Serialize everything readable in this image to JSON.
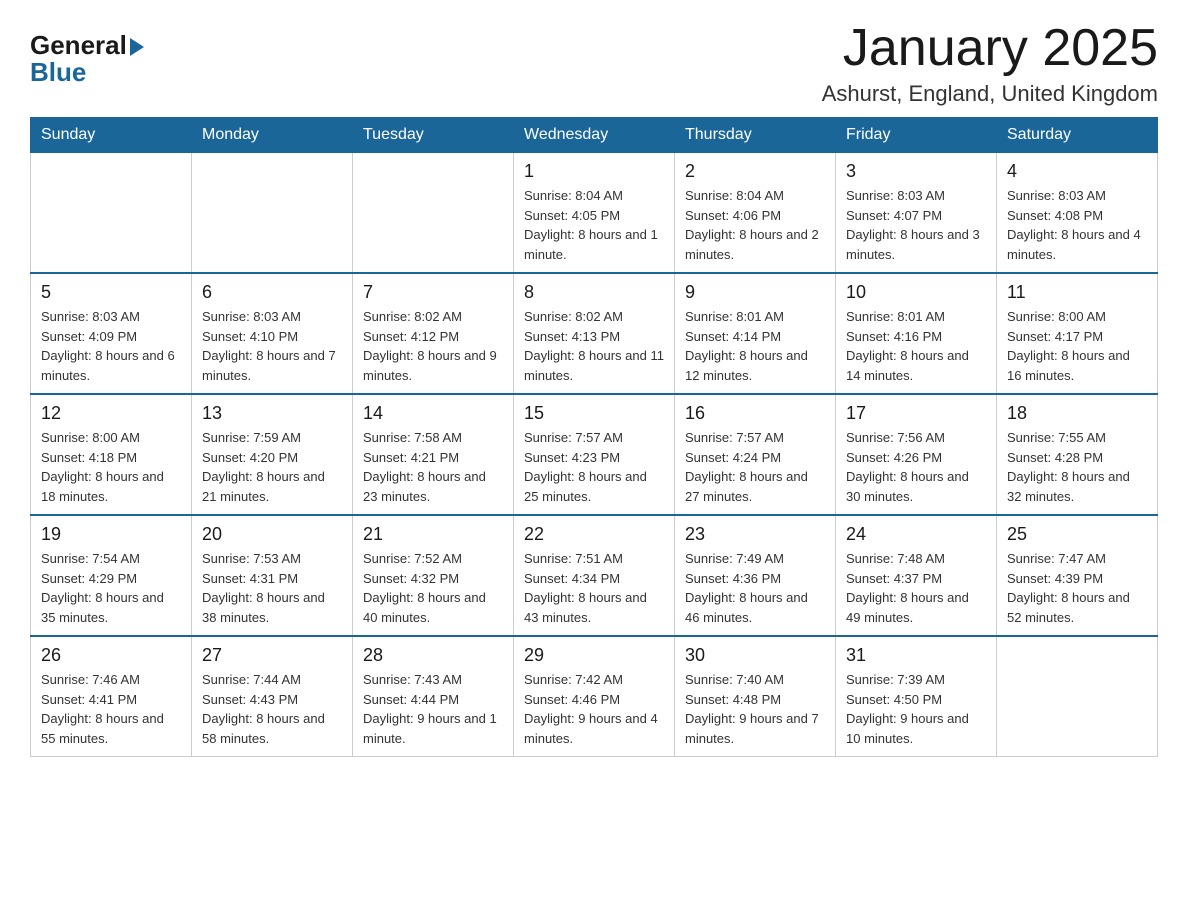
{
  "header": {
    "logo_general": "General",
    "logo_blue": "Blue",
    "title": "January 2025",
    "subtitle": "Ashurst, England, United Kingdom"
  },
  "days_of_week": [
    "Sunday",
    "Monday",
    "Tuesday",
    "Wednesday",
    "Thursday",
    "Friday",
    "Saturday"
  ],
  "weeks": [
    [
      {
        "day": "",
        "info": ""
      },
      {
        "day": "",
        "info": ""
      },
      {
        "day": "",
        "info": ""
      },
      {
        "day": "1",
        "info": "Sunrise: 8:04 AM\nSunset: 4:05 PM\nDaylight: 8 hours and 1 minute."
      },
      {
        "day": "2",
        "info": "Sunrise: 8:04 AM\nSunset: 4:06 PM\nDaylight: 8 hours and 2 minutes."
      },
      {
        "day": "3",
        "info": "Sunrise: 8:03 AM\nSunset: 4:07 PM\nDaylight: 8 hours and 3 minutes."
      },
      {
        "day": "4",
        "info": "Sunrise: 8:03 AM\nSunset: 4:08 PM\nDaylight: 8 hours and 4 minutes."
      }
    ],
    [
      {
        "day": "5",
        "info": "Sunrise: 8:03 AM\nSunset: 4:09 PM\nDaylight: 8 hours and 6 minutes."
      },
      {
        "day": "6",
        "info": "Sunrise: 8:03 AM\nSunset: 4:10 PM\nDaylight: 8 hours and 7 minutes."
      },
      {
        "day": "7",
        "info": "Sunrise: 8:02 AM\nSunset: 4:12 PM\nDaylight: 8 hours and 9 minutes."
      },
      {
        "day": "8",
        "info": "Sunrise: 8:02 AM\nSunset: 4:13 PM\nDaylight: 8 hours and 11 minutes."
      },
      {
        "day": "9",
        "info": "Sunrise: 8:01 AM\nSunset: 4:14 PM\nDaylight: 8 hours and 12 minutes."
      },
      {
        "day": "10",
        "info": "Sunrise: 8:01 AM\nSunset: 4:16 PM\nDaylight: 8 hours and 14 minutes."
      },
      {
        "day": "11",
        "info": "Sunrise: 8:00 AM\nSunset: 4:17 PM\nDaylight: 8 hours and 16 minutes."
      }
    ],
    [
      {
        "day": "12",
        "info": "Sunrise: 8:00 AM\nSunset: 4:18 PM\nDaylight: 8 hours and 18 minutes."
      },
      {
        "day": "13",
        "info": "Sunrise: 7:59 AM\nSunset: 4:20 PM\nDaylight: 8 hours and 21 minutes."
      },
      {
        "day": "14",
        "info": "Sunrise: 7:58 AM\nSunset: 4:21 PM\nDaylight: 8 hours and 23 minutes."
      },
      {
        "day": "15",
        "info": "Sunrise: 7:57 AM\nSunset: 4:23 PM\nDaylight: 8 hours and 25 minutes."
      },
      {
        "day": "16",
        "info": "Sunrise: 7:57 AM\nSunset: 4:24 PM\nDaylight: 8 hours and 27 minutes."
      },
      {
        "day": "17",
        "info": "Sunrise: 7:56 AM\nSunset: 4:26 PM\nDaylight: 8 hours and 30 minutes."
      },
      {
        "day": "18",
        "info": "Sunrise: 7:55 AM\nSunset: 4:28 PM\nDaylight: 8 hours and 32 minutes."
      }
    ],
    [
      {
        "day": "19",
        "info": "Sunrise: 7:54 AM\nSunset: 4:29 PM\nDaylight: 8 hours and 35 minutes."
      },
      {
        "day": "20",
        "info": "Sunrise: 7:53 AM\nSunset: 4:31 PM\nDaylight: 8 hours and 38 minutes."
      },
      {
        "day": "21",
        "info": "Sunrise: 7:52 AM\nSunset: 4:32 PM\nDaylight: 8 hours and 40 minutes."
      },
      {
        "day": "22",
        "info": "Sunrise: 7:51 AM\nSunset: 4:34 PM\nDaylight: 8 hours and 43 minutes."
      },
      {
        "day": "23",
        "info": "Sunrise: 7:49 AM\nSunset: 4:36 PM\nDaylight: 8 hours and 46 minutes."
      },
      {
        "day": "24",
        "info": "Sunrise: 7:48 AM\nSunset: 4:37 PM\nDaylight: 8 hours and 49 minutes."
      },
      {
        "day": "25",
        "info": "Sunrise: 7:47 AM\nSunset: 4:39 PM\nDaylight: 8 hours and 52 minutes."
      }
    ],
    [
      {
        "day": "26",
        "info": "Sunrise: 7:46 AM\nSunset: 4:41 PM\nDaylight: 8 hours and 55 minutes."
      },
      {
        "day": "27",
        "info": "Sunrise: 7:44 AM\nSunset: 4:43 PM\nDaylight: 8 hours and 58 minutes."
      },
      {
        "day": "28",
        "info": "Sunrise: 7:43 AM\nSunset: 4:44 PM\nDaylight: 9 hours and 1 minute."
      },
      {
        "day": "29",
        "info": "Sunrise: 7:42 AM\nSunset: 4:46 PM\nDaylight: 9 hours and 4 minutes."
      },
      {
        "day": "30",
        "info": "Sunrise: 7:40 AM\nSunset: 4:48 PM\nDaylight: 9 hours and 7 minutes."
      },
      {
        "day": "31",
        "info": "Sunrise: 7:39 AM\nSunset: 4:50 PM\nDaylight: 9 hours and 10 minutes."
      },
      {
        "day": "",
        "info": ""
      }
    ]
  ]
}
